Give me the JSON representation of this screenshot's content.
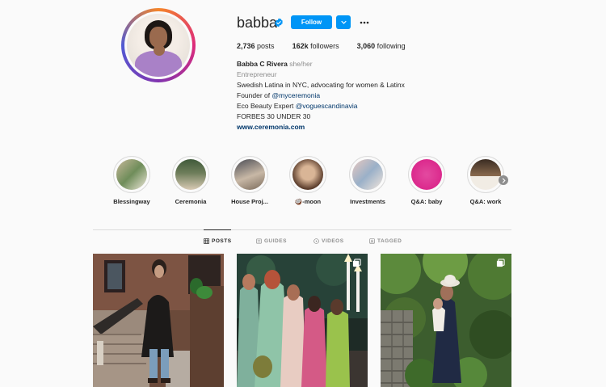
{
  "profile": {
    "username": "babba",
    "follow_label": "Follow",
    "posts_count": "2,736",
    "posts_label": "posts",
    "followers_count": "162k",
    "followers_label": "followers",
    "following_count": "3,060",
    "following_label": "following",
    "full_name": "Babba C Rivera",
    "pronouns": "she/her",
    "category": "Entrepreneur",
    "bio_line1": "Swedish Latina in NYC, advocating for women & Latinx",
    "bio_line2_prefix": "Founder of ",
    "bio_line2_link": "@myceremonia",
    "bio_line3_prefix": "Eco Beauty Expert ",
    "bio_line3_link": "@voguescandinavia",
    "bio_line4": "FORBES 30 UNDER 30",
    "website": "www.ceremonia.com"
  },
  "highlights": [
    {
      "label": "Blessingway"
    },
    {
      "label": "Ceremonia"
    },
    {
      "label": "House Proj..."
    },
    {
      "label": "🥥-moon"
    },
    {
      "label": "Investments"
    },
    {
      "label": "Q&A: baby"
    },
    {
      "label": "Q&A: work"
    }
  ],
  "tabs": [
    {
      "label": "POSTS",
      "active": true
    },
    {
      "label": "GUIDES",
      "active": false
    },
    {
      "label": "VIDEOS",
      "active": false
    },
    {
      "label": "TAGGED",
      "active": false
    }
  ],
  "colors": {
    "accent": "#0095f6",
    "link": "#00376b",
    "muted": "#8e8e8e",
    "text": "#262626"
  },
  "icons": [
    "verified-badge-icon",
    "chevron-down-icon",
    "more-options-icon",
    "grid-icon",
    "guides-icon",
    "videos-icon",
    "tagged-icon",
    "carousel-icon",
    "next-arrow-icon"
  ]
}
